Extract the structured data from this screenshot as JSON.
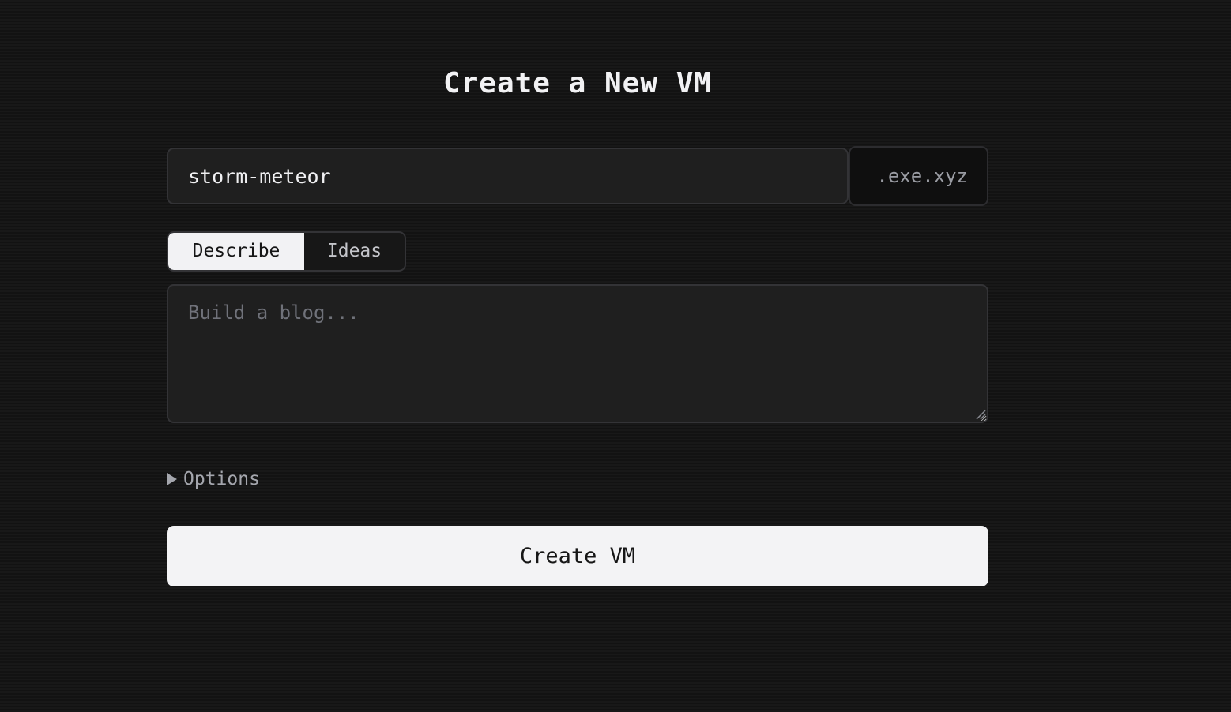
{
  "page": {
    "title": "Create a New VM"
  },
  "name_field": {
    "value": "storm-meteor",
    "domain_suffix": ".exe.xyz"
  },
  "tabs": [
    {
      "label": "Describe",
      "selected": true
    },
    {
      "label": "Ideas",
      "selected": false
    }
  ],
  "prompt": {
    "value": "",
    "placeholder": "Build a blog..."
  },
  "options": {
    "label": "Options",
    "expanded": false
  },
  "submit": {
    "label": "Create VM"
  },
  "colors": {
    "background": "#121212",
    "field_background": "#1f1f1f",
    "border": "#333336",
    "primary_button": "#f3f3f5",
    "muted_text": "#a4a6ad"
  }
}
